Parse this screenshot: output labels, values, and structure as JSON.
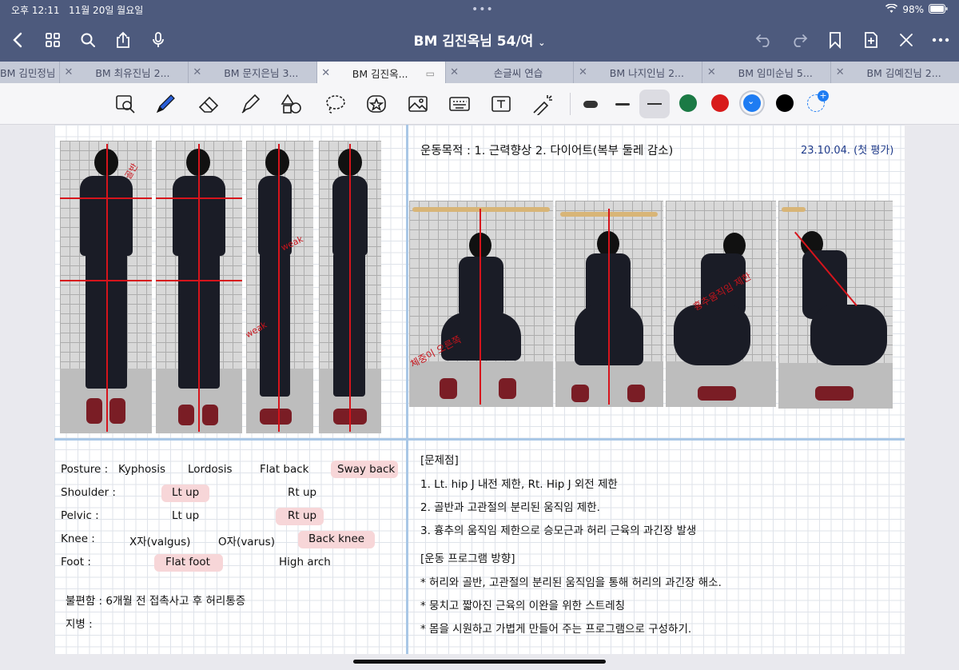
{
  "status": {
    "time": "오후 12:11",
    "date": "11월 20일 월요일",
    "battery": "98%"
  },
  "document": {
    "title": "BM 김진옥님 54/여"
  },
  "tabs": [
    {
      "label": "BM 김민정님 3..."
    },
    {
      "label": "BM 최유진님 2..."
    },
    {
      "label": "BM 문지은님 3..."
    },
    {
      "label": "BM 김진옥..."
    },
    {
      "label": "손글씨 연습"
    },
    {
      "label": "BM 나지인님 2..."
    },
    {
      "label": "BM 임미순님 5..."
    },
    {
      "label": "BM 김예진님 2..."
    }
  ],
  "colors": {
    "green": "#1b7a45",
    "red": "#d81b1b",
    "blue": "#1e7cf2",
    "black": "#000000",
    "nav": "#4d5a7d"
  },
  "notes": {
    "goal": "운동목적 : 1. 근력향상 2. 다이어트(복부 둘레 감소)",
    "date": "23.10.04. (첫 평가)",
    "posture_label": "Posture :",
    "posture": [
      "Kyphosis",
      "Lordosis",
      "Flat back",
      "Sway back"
    ],
    "shoulder_label": "Shoulder :",
    "shoulder": [
      "Lt up",
      "Rt up"
    ],
    "pelvic_label": "Pelvic :",
    "pelvic": [
      "Lt up",
      "Rt up"
    ],
    "knee_label": "Knee :",
    "knee": [
      "X자(valgus)",
      "O자(varus)",
      "Back knee"
    ],
    "foot_label": "Foot :",
    "foot": [
      "Flat foot",
      "High arch"
    ],
    "discomfort": "불편함 : 6개월 전 접촉사고 후 허리통증",
    "disease": "지병 :",
    "problems_title": "[문제점]",
    "problems": [
      "1. Lt. hip J 내전 제한, Rt. Hip J 외전 제한",
      "2. 골반과 고관절의 분리된 움직임 제한.",
      "3. 흉추의 움직임 제한으로 승모근과 허리 근육의 과긴장 발생"
    ],
    "program_title": "[운동 프로그램 방향]",
    "program": [
      "* 허리와 골반, 고관절의 분리된 움직임을 통해 허리의 과긴장 해소.",
      "* 뭉치고 짧아진 근육의 이완을 위한 스트레칭",
      "* 몸을 시원하고 가볍게 만들어 주는 프로그램으로 구성하기."
    ]
  },
  "annotations": {
    "photo1": "골반",
    "photo3a": "weak",
    "photo3b": "weak",
    "squat1": "체중이 오른쪽",
    "squat3": "흉추움직임 제한"
  }
}
